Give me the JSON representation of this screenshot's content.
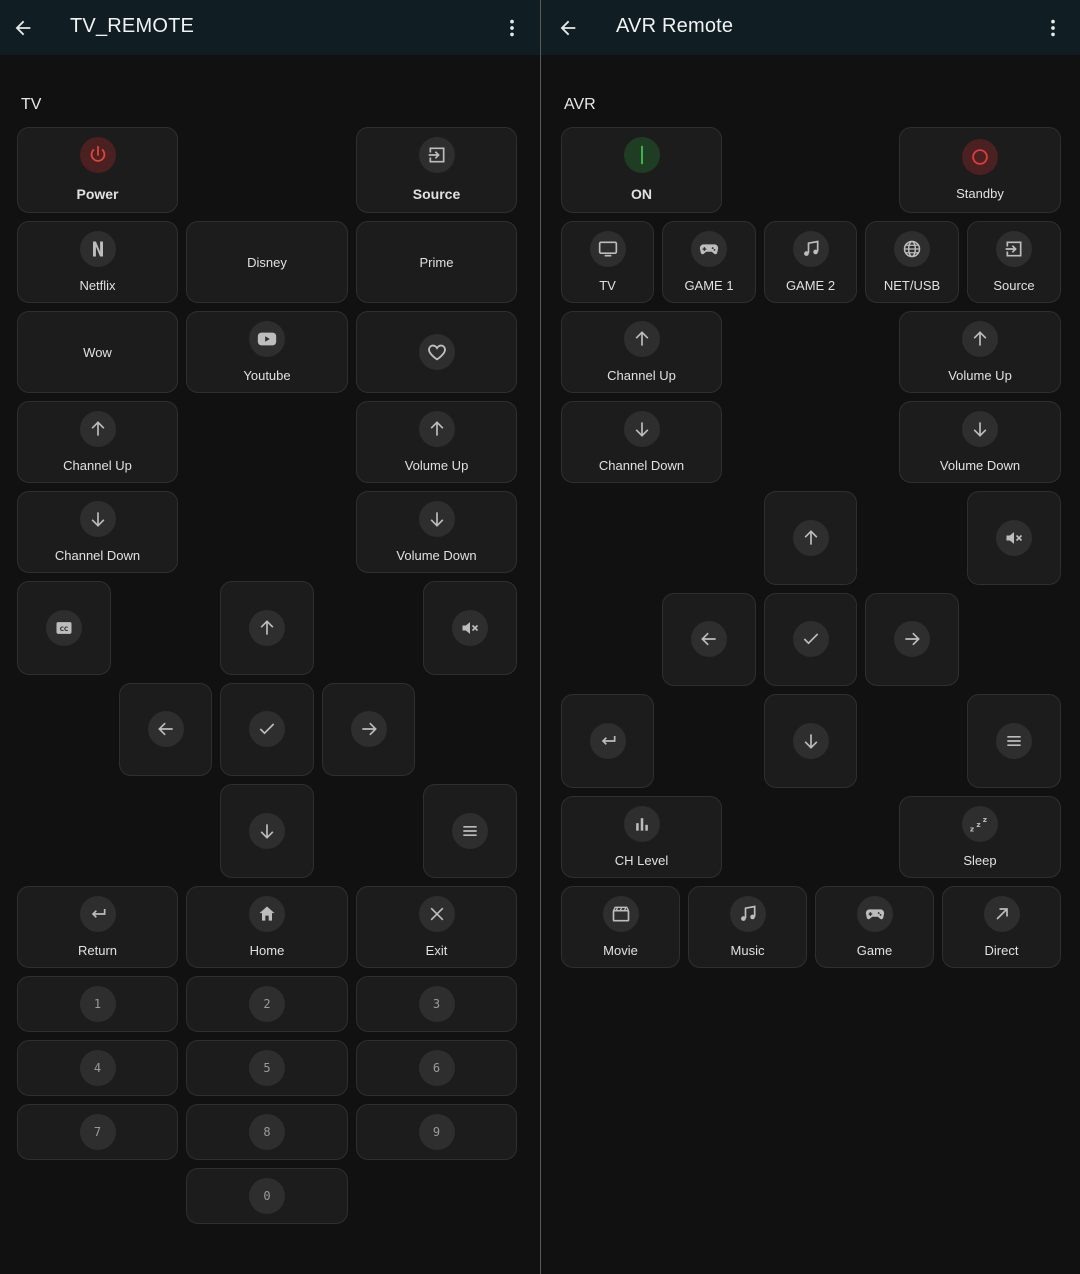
{
  "tv": {
    "title": "TV_REMOTE",
    "section": "TV",
    "power": "Power",
    "source": "Source",
    "netflix": "Netflix",
    "disney": "Disney",
    "prime": "Prime",
    "wow": "Wow",
    "youtube": "Youtube",
    "channel_up": "Channel Up",
    "volume_up": "Volume Up",
    "channel_down": "Channel Down",
    "volume_down": "Volume Down",
    "return": "Return",
    "home": "Home",
    "exit": "Exit",
    "digits": [
      "1",
      "2",
      "3",
      "4",
      "5",
      "6",
      "7",
      "8",
      "9",
      "0"
    ]
  },
  "avr": {
    "title": "AVR Remote",
    "section": "AVR",
    "on": "ON",
    "standby": "Standby",
    "inputs": [
      "TV",
      "GAME 1",
      "GAME 2",
      "NET/USB",
      "Source"
    ],
    "channel_up": "Channel Up",
    "volume_up": "Volume Up",
    "channel_down": "Channel Down",
    "volume_down": "Volume Down",
    "ch_level": "CH Level",
    "sleep": "Sleep",
    "modes": [
      "Movie",
      "Music",
      "Game",
      "Direct"
    ]
  },
  "colors": {
    "power_red": "#e0443b",
    "on_green": "#3fbf4f",
    "standby_red": "#e23b3b",
    "topbar": "#101e24",
    "tile": "#1c1c1c"
  }
}
